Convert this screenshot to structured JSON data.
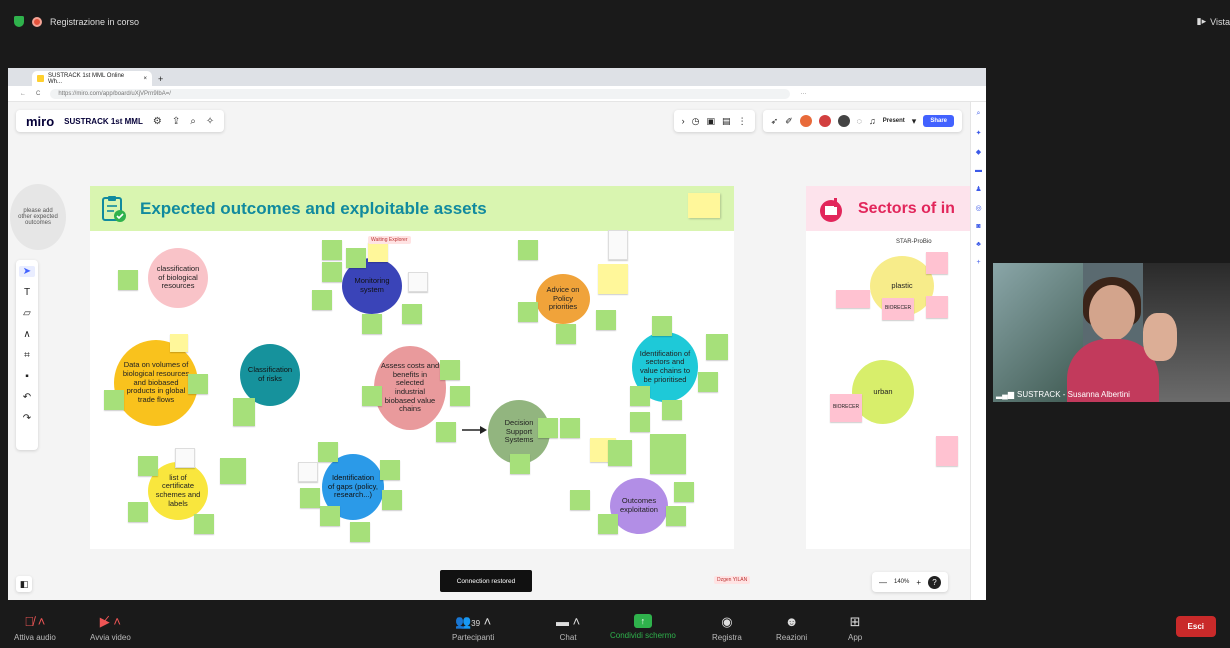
{
  "zoom_top": {
    "recording_text": "Registrazione in corso",
    "view_label": "Vista"
  },
  "browser": {
    "tab_title": "SUSTRACK 1st MML Online Wh...",
    "url": "https://miro.com/app/board/uXjVPrn9IbA=/"
  },
  "miro": {
    "logo": "miro",
    "board_name": "SUSTRACK 1st MML",
    "present_label": "Present",
    "share_label": "Share",
    "zoom_level": "140%",
    "toast": "Connection restored",
    "side_note": "please add other expected outcomes",
    "collaborator_tag_1": "Waiting Explorer",
    "collaborator_tag_2": "Dzgen YILAN"
  },
  "frame_main": {
    "title": "Expected outcomes and exploitable assets"
  },
  "frame_right": {
    "title": "Sectors of in"
  },
  "circles": [
    {
      "name": "classification-biological-resources",
      "text": "classification of biological resources",
      "color": "#f9c3c8"
    },
    {
      "name": "monitoring-system",
      "text": "Monitoring system",
      "color": "#3a44b8"
    },
    {
      "name": "advice-policy-priorities",
      "text": "Advice on Policy priorities",
      "color": "#f0a33a"
    },
    {
      "name": "data-volumes",
      "text": "Data on volumes of biological resources and biobased products in global trade flows",
      "color": "#f9c21d"
    },
    {
      "name": "classification-risks",
      "text": "Classification of risks",
      "color": "#16929c"
    },
    {
      "name": "assess-costs",
      "text": "Assess costs and benefits in selected industrial biobased value chains",
      "color": "#e99a9c"
    },
    {
      "name": "identification-sectors",
      "text": "Identification of sectors and value chains to be prioritised",
      "color": "#1ec9d8"
    },
    {
      "name": "decision-support",
      "text": "Decision Support Systems",
      "color": "#92b57f"
    },
    {
      "name": "list-certificate",
      "text": "list of certificate schemes and labels",
      "color": "#f9e63d"
    },
    {
      "name": "identification-gaps",
      "text": "Identification of gaps (policy, research...)",
      "color": "#2b9ae8"
    },
    {
      "name": "outcomes-exploitation",
      "text": "Outcomes exploitation",
      "color": "#b28ee6"
    }
  ],
  "right_frame_items": {
    "star_label": "STAR-ProBio",
    "plastic": "plastic",
    "urban": "urban",
    "biorecer_1": "BIORECER",
    "biorecer_2": "BIORECER"
  },
  "webcam": {
    "name": "SUSTRACK - Susanna Albertini"
  },
  "zoom_bar": {
    "audio": "Attiva audio",
    "video": "Avvia video",
    "participants": "Partecipanti",
    "participants_count": "39",
    "chat": "Chat",
    "share": "Condividi schermo",
    "record": "Registra",
    "reactions": "Reazioni",
    "apps": "App",
    "exit": "Esci"
  }
}
